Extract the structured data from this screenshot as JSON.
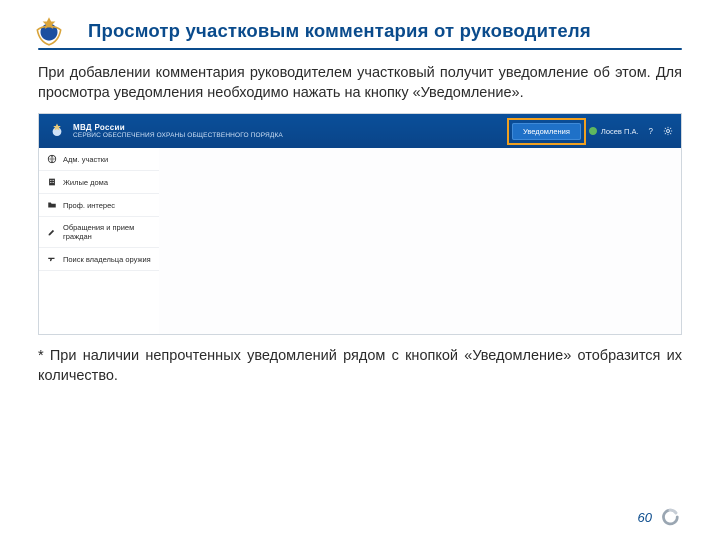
{
  "title": "Просмотр участковым комментария от руководителя",
  "paragraph": "При добавлении комментария руководителем участковый получит уведомление об этом. Для просмотра уведомления необходимо нажать на кнопку «Уведомление».",
  "footnote": "* При наличии непрочтенных уведомлений рядом с кнопкой «Уведомление» отобразится их количество.",
  "page_number": "60",
  "app": {
    "brand_line1": "МВД России",
    "brand_line2": "СЕРВИС ОБЕСПЕЧЕНИЯ ОХРАНЫ ОБЩЕСТВЕННОГО ПОРЯДКА",
    "notification_button": "Уведомления",
    "user_name": "Лосев П.А.",
    "help_label": "?",
    "sidebar": [
      {
        "icon": "globe",
        "label": "Адм. участки"
      },
      {
        "icon": "building",
        "label": "Жилые дома"
      },
      {
        "icon": "folder",
        "label": "Проф. интерес"
      },
      {
        "icon": "edit",
        "label": "Обращения и прием граждан"
      },
      {
        "icon": "gun",
        "label": "Поиск владельца оружия"
      }
    ]
  }
}
